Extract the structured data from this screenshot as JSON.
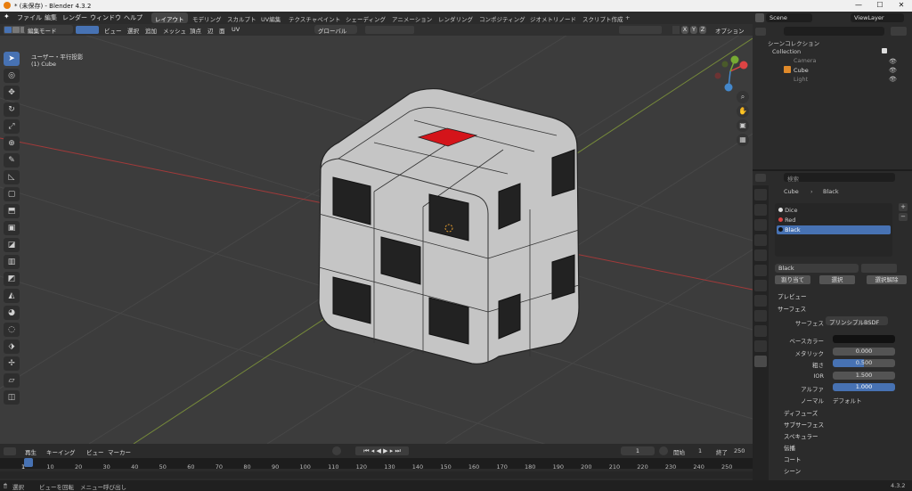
{
  "window": {
    "title": "* (未保存) - Blender 4.3.2",
    "minimize": "—",
    "maximize": "☐",
    "close": "✕"
  },
  "menus": [
    "ファイル",
    "編集",
    "レンダー",
    "ウィンドウ",
    "ヘルプ"
  ],
  "workspaces": [
    "レイアウト",
    "モデリング",
    "スカルプト",
    "UV編集",
    "テクスチャペイント",
    "シェーディング",
    "アニメーション",
    "レンダリング",
    "コンポジティング",
    "ジオメトリノード",
    "スクリプト作成",
    "+"
  ],
  "active_workspace": "レイアウト",
  "scene": {
    "label": "Scene",
    "viewlayer": "ViewLayer"
  },
  "viewport_header": {
    "mode": "編集モード",
    "menus": [
      "ビュー",
      "選択",
      "追加",
      "メッシュ",
      "頂点",
      "辺",
      "面",
      "UV"
    ],
    "transform": "グローバル",
    "xyz": [
      "X",
      "Y",
      "Z"
    ],
    "options": "オプション"
  },
  "viewport": {
    "view_name": "ユーザー・平行投影",
    "object_name": "(1) Cube",
    "gizmo": {
      "x": "X",
      "y": "Y",
      "z": "Z"
    }
  },
  "toolbar_icons": [
    "select-icon",
    "cursor-icon",
    "move-icon",
    "rotate-icon",
    "scale-icon",
    "transform-icon",
    "annotate-icon",
    "measure-icon",
    "add-cube-icon",
    "extrude-icon",
    "inset-icon",
    "bevel-icon",
    "loopcut-icon",
    "knife-icon",
    "polybuild-icon",
    "spin-icon",
    "smooth-icon",
    "edge-slide-icon",
    "shrink-icon",
    "shear-icon",
    "rip-icon"
  ],
  "outliner": {
    "search_placeholder": "",
    "scene_collection": "シーンコレクション",
    "collection": "Collection",
    "items": [
      {
        "name": "Camera"
      },
      {
        "name": "Cube"
      },
      {
        "name": "Light"
      }
    ]
  },
  "properties": {
    "search_placeholder": "検索",
    "breadcrumb_object": "Cube",
    "breadcrumb_material": "Black",
    "material_slots": [
      {
        "name": "Dice"
      },
      {
        "name": "Red"
      },
      {
        "name": "Black"
      }
    ],
    "material_name": "Black",
    "buttons": {
      "assign": "割り当て",
      "select": "選択",
      "deselect": "選択解除"
    },
    "panels": {
      "preview": "プレビュー",
      "surface": "サーフェス"
    },
    "surface_label": "サーフェス",
    "surface_value": "プリンシプルBSDF",
    "fields": [
      {
        "label": "ベースカラー",
        "value": ""
      },
      {
        "label": "メタリック",
        "value": "0.000"
      },
      {
        "label": "粗さ",
        "value": "0.500"
      },
      {
        "label": "IOR",
        "value": "1.500"
      },
      {
        "label": "アルファ",
        "value": "1.000"
      },
      {
        "label": "ノーマル",
        "value": "デフォルト"
      }
    ],
    "subpanels": [
      "ディフューズ",
      "サブサーフェス",
      "スペキュラー",
      "伝播",
      "コート",
      "シーン"
    ]
  },
  "timeline": {
    "menus": [
      "再生",
      "キーイング",
      "ビュー",
      "マーカー"
    ],
    "current_frame": "1",
    "start_label": "開始",
    "start_value": "1",
    "end_label": "終了",
    "end_value": "250",
    "ticks": [
      "1",
      "10",
      "20",
      "30",
      "40",
      "50",
      "60",
      "70",
      "80",
      "90",
      "100",
      "110",
      "120",
      "130",
      "140",
      "150",
      "160",
      "170",
      "180",
      "190",
      "200",
      "210",
      "220",
      "230",
      "240",
      "250"
    ]
  },
  "statusbar": {
    "select": "選択",
    "rotate": "ビューを回転",
    "menu": "メニュー呼び出し",
    "version": "4.3.2"
  },
  "colors": {
    "selected_face": "#d4141a",
    "accent": "#4772b3"
  }
}
